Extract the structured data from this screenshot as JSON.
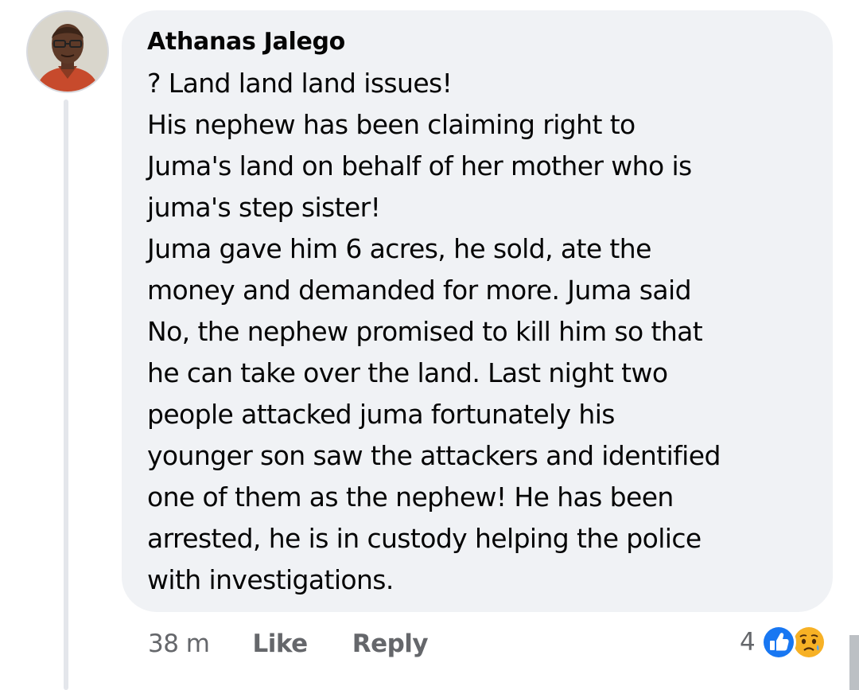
{
  "comment": {
    "author": "Athanas Jalego",
    "lines": [
      "? Land land land issues!",
      "His nephew has been claiming right to",
      "Juma's land on behalf of her mother who is",
      "juma's step sister!",
      "Juma gave him 6 acres, he sold, ate the",
      "money and demanded for more. Juma said",
      "No, the nephew promised to kill him so that",
      "he can take over the land. Last night two",
      "people attacked juma fortunately his",
      "younger son saw the attackers and identified",
      "one of them as the nephew! He has been",
      "arrested, he is in custody helping the police",
      "with investigations."
    ]
  },
  "actions": {
    "time": "38 m",
    "like_label": "Like",
    "reply_label": "Reply"
  },
  "reactions": {
    "count": "4",
    "icons": [
      "like-reaction-icon",
      "sad-reaction-icon"
    ],
    "like_color": "#1877f2",
    "sad_color": "#f7b125"
  }
}
